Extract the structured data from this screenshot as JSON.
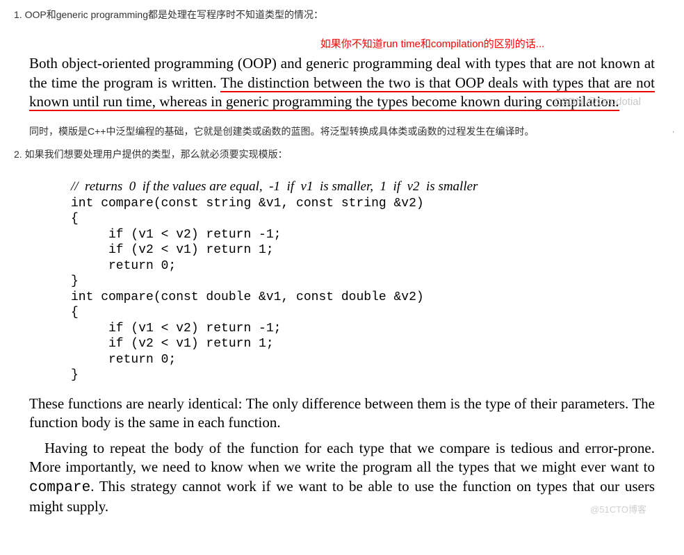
{
  "item1": {
    "num": "1. ",
    "text": "OOP和generic programming都是处理在写程序时不知道类型的情况："
  },
  "red_note": "如果你不知道run time和compilation的区别的话...",
  "excerpt1": {
    "plain_a": "Both object-oriented programming (OOP) and generic programming deal with types that are not known at the time the program is written. ",
    "ul_a": "The distinction between the two is that OOP deals with types that are not known until run time, whereas in generic programming the types become known during compilation."
  },
  "watermark_csdn": "CSDN @Ocodotial",
  "small_mark": ",",
  "cn_para": "同时，模版是C++中泛型编程的基础，它就是创建类或函数的蓝图。将泛型转换成具体类或函数的过程发生在编译时。",
  "item2": {
    "num": "2. ",
    "text": "如果我们想要处理用户提供的类型，那么就必须要实现模版："
  },
  "code": {
    "comment": "//  returns  0  if the values are equal,  -1  if  v1  is smaller,  1  if  v2  is smaller",
    "l1": "int compare(const string &v1, const string &v2)",
    "l2": "{",
    "l3": "     if (v1 < v2) return -1;",
    "l4": "     if (v2 < v1) return 1;",
    "l5": "     return 0;",
    "l6": "}",
    "l7": "int compare(const double &v1, const double &v2)",
    "l8": "{",
    "l9": "     if (v1 < v2) return -1;",
    "l10": "     if (v2 < v1) return 1;",
    "l11": "     return 0;",
    "l12": "}"
  },
  "excerpt2": "These functions are nearly identical: The only difference between them is the type of their parameters. The function body is the same in each function.",
  "excerpt3": {
    "plain_a": "Having to repeat the body of the function for each type that we compare is tedious and error-prone. ",
    "ul_a": "More importantly, we need to know when we write the program all the types that we might ever want to ",
    "mono": "compare",
    "ul_b": ". This strategy cannot work if we want to be able to use the function on types that our users might supply."
  },
  "watermark_cto": "@51CTO博客"
}
